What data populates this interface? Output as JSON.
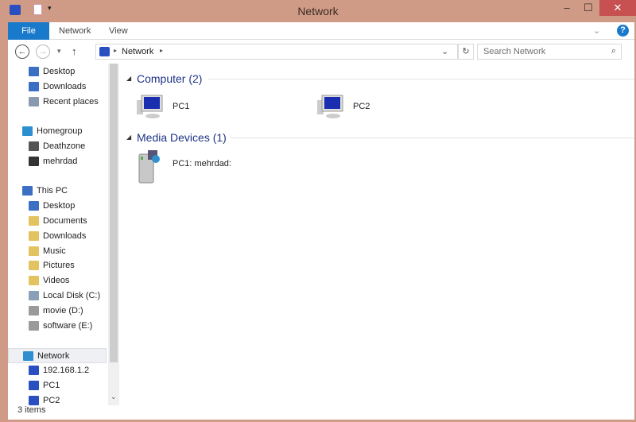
{
  "window": {
    "title": "Network",
    "colors": {
      "frame": "#d09b86",
      "file_tab": "#1979ca",
      "close": "#c75050"
    }
  },
  "titlebar": {
    "minimize": "–",
    "maximize": "☐",
    "close": "✕"
  },
  "ribbon": {
    "tabs": [
      "File",
      "Network",
      "View"
    ],
    "help": "?"
  },
  "address": {
    "path": "Network",
    "search_placeholder": "Search Network"
  },
  "sidebar": {
    "rows": [
      {
        "label": "Desktop",
        "indent": 1,
        "color": "#3a6fc4"
      },
      {
        "label": "Downloads",
        "indent": 1,
        "color": "#3a6fc4"
      },
      {
        "label": "Recent places",
        "indent": 1,
        "color": "#8a9aae"
      },
      null,
      {
        "label": "Homegroup",
        "indent": 0,
        "color": "#2d8fd0"
      },
      {
        "label": "Deathzone",
        "indent": 1,
        "color": "#555"
      },
      {
        "label": "mehrdad",
        "indent": 1,
        "color": "#333"
      },
      null,
      {
        "label": "This PC",
        "indent": 0,
        "color": "#3a6fc4"
      },
      {
        "label": "Desktop",
        "indent": 1,
        "color": "#3a6fc4"
      },
      {
        "label": "Documents",
        "indent": 1,
        "color": "#e3c260"
      },
      {
        "label": "Downloads",
        "indent": 1,
        "color": "#e3c260"
      },
      {
        "label": "Music",
        "indent": 1,
        "color": "#e3c260"
      },
      {
        "label": "Pictures",
        "indent": 1,
        "color": "#e3c260"
      },
      {
        "label": "Videos",
        "indent": 1,
        "color": "#e3c260"
      },
      {
        "label": "Local Disk (C:)",
        "indent": 1,
        "color": "#8aa0b8"
      },
      {
        "label": "movie (D:)",
        "indent": 1,
        "color": "#9a9a9a"
      },
      {
        "label": "software (E:)",
        "indent": 1,
        "color": "#9a9a9a"
      },
      null,
      {
        "label": "Network",
        "indent": 0,
        "color": "#2d8fd0",
        "selected": true
      },
      {
        "label": "192.168.1.2",
        "indent": 1,
        "color": "#2a4fc0"
      },
      {
        "label": "PC1",
        "indent": 1,
        "color": "#2a4fc0"
      },
      {
        "label": "PC2",
        "indent": 1,
        "color": "#2a4fc0"
      }
    ]
  },
  "content": {
    "groups": [
      {
        "title": "Computer (2)",
        "items": [
          "PC1",
          "PC2"
        ]
      },
      {
        "title": "Media Devices (1)",
        "items": [
          "PC1: mehrdad:"
        ]
      }
    ]
  },
  "status": {
    "text": "3 items"
  }
}
